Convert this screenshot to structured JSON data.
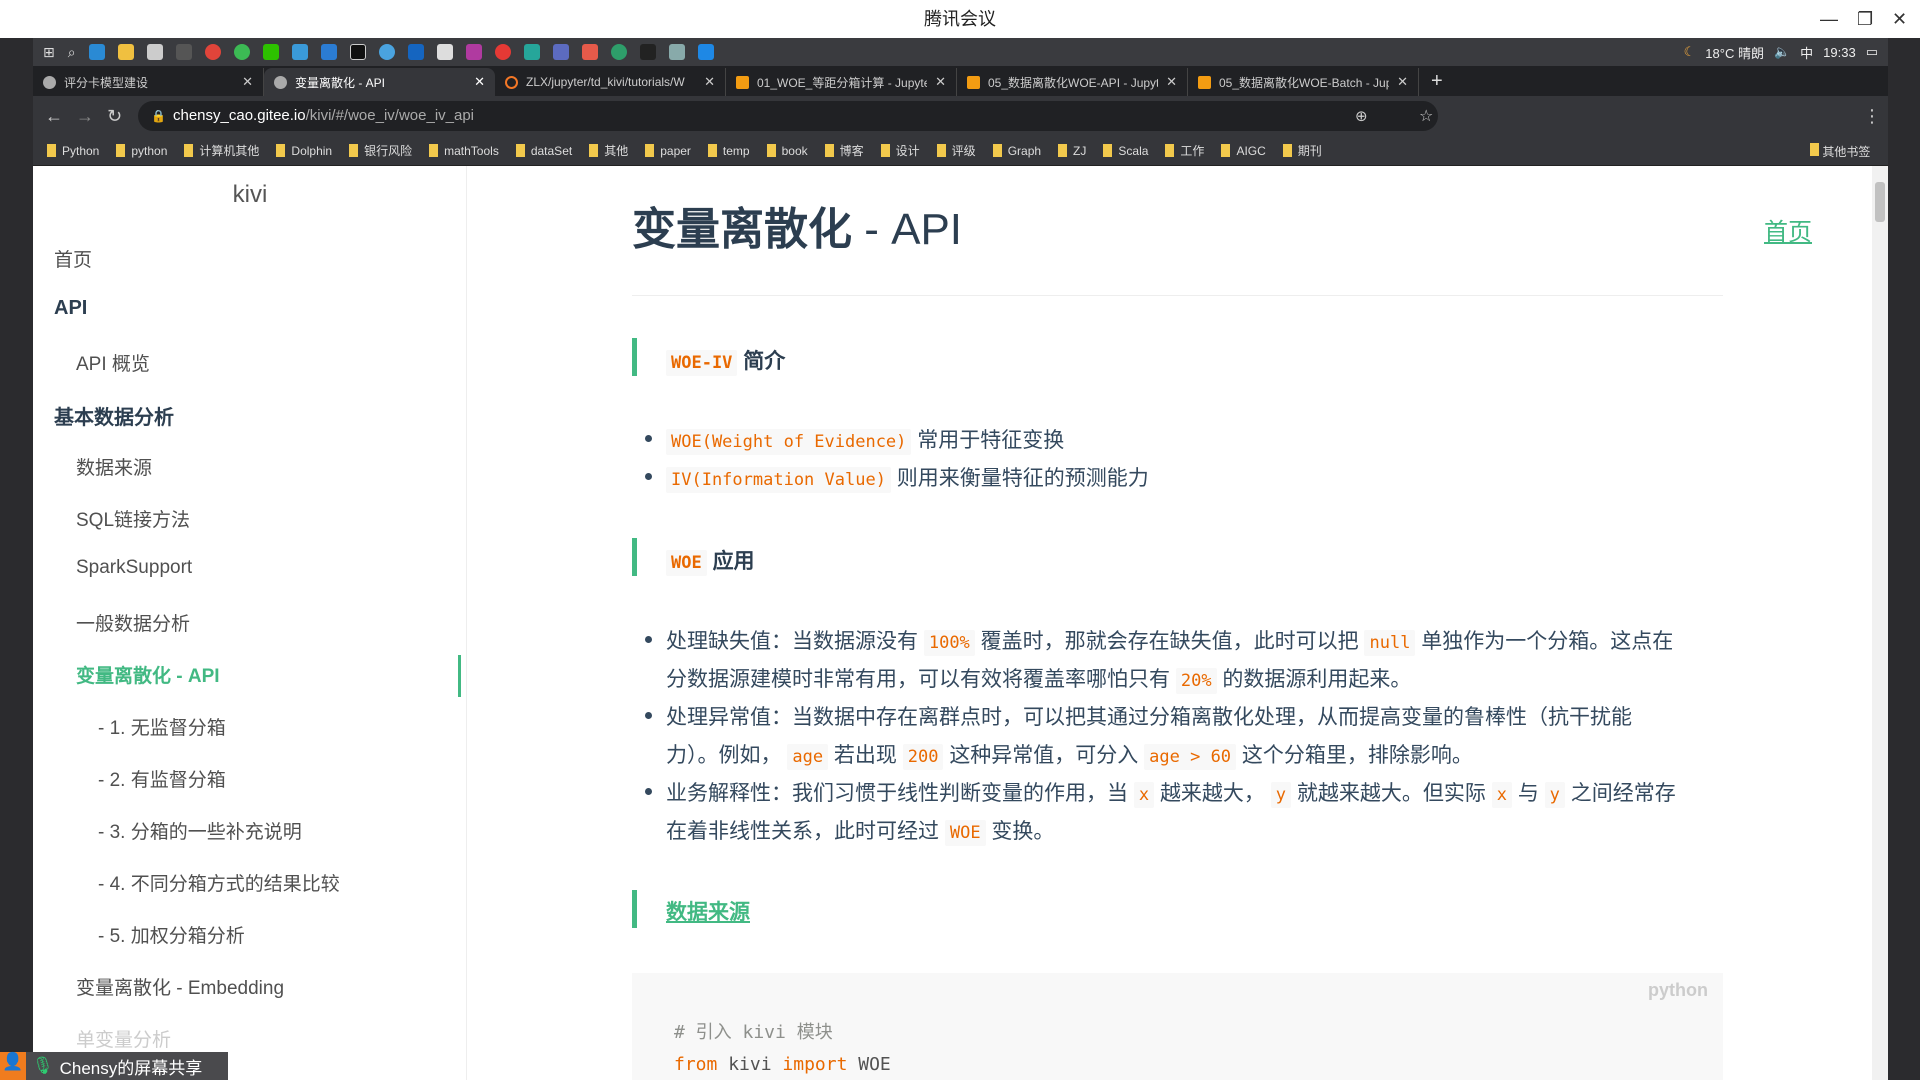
{
  "window": {
    "title": "腾讯会议"
  },
  "taskbar": {
    "weather": "18°C 晴朗",
    "ime": "中",
    "time": "19:33"
  },
  "tabs": [
    {
      "label": "评分卡模型建设"
    },
    {
      "label": "变量离散化 - API",
      "active": true
    },
    {
      "label": "ZLX/jupyter/td_kivi/tutorials/W"
    },
    {
      "label": "01_WOE_等距分箱计算 - Jupyte"
    },
    {
      "label": "05_数据离散化WOE-API - Jupyt"
    },
    {
      "label": "05_数据离散化WOE-Batch - Jup"
    }
  ],
  "address": {
    "host": "chensy_cao.gitee.io",
    "path": "/kivi/#/woe_iv/woe_iv_api"
  },
  "bookmarks": [
    "Python",
    "python",
    "计算机其他",
    "Dolphin",
    "银行风险",
    "mathTools",
    "dataSet",
    "其他",
    "paper",
    "temp",
    "book",
    "博客",
    "设计",
    "评级",
    "Graph",
    "ZJ",
    "Scala",
    "工作",
    "AIGC",
    "期刊"
  ],
  "other_bookmarks": "其他书签",
  "sidebar": {
    "title": "kivi",
    "items": [
      {
        "label": "首页",
        "level": 0
      },
      {
        "label": "API",
        "level": "h"
      },
      {
        "label": "API 概览",
        "level": 1
      },
      {
        "label": "基本数据分析",
        "level": "h"
      },
      {
        "label": "数据来源",
        "level": 1
      },
      {
        "label": "SQL链接方法",
        "level": 1
      },
      {
        "label": "SparkSupport",
        "level": 1
      },
      {
        "label": "一般数据分析",
        "level": 1
      },
      {
        "label": "变量离散化 - API",
        "level": 1,
        "active": true
      },
      {
        "label": "- 1. 无监督分箱",
        "level": 2
      },
      {
        "label": "- 2. 有监督分箱",
        "level": 2
      },
      {
        "label": "- 3. 分箱的一些补充说明",
        "level": 2
      },
      {
        "label": "- 4. 不同分箱方式的结果比较",
        "level": 2
      },
      {
        "label": "- 5. 加权分箱分析",
        "level": 2
      },
      {
        "label": "变量离散化 - Embedding",
        "level": 1
      },
      {
        "label": "单变量分析",
        "level": 1,
        "faded": true
      }
    ]
  },
  "main": {
    "title_a": "变量离散化",
    "title_b": " - API",
    "home_link": "首页",
    "s1": {
      "code": "WOE-IV",
      "text": "简介"
    },
    "s1_items": [
      {
        "code": "WOE(Weight of Evidence)",
        "text": "常用于特征变换"
      },
      {
        "code": "IV(Information Value)",
        "text": "则用来衡量特征的预测能力"
      }
    ],
    "s2": {
      "code": "WOE",
      "text": "应用"
    },
    "b1": {
      "a": "处理缺失值：当数据源没有",
      "c1": "100%",
      "b": "覆盖时，那就会存在缺失值，此时可以把",
      "c2": "null",
      "c": "单独作为一个分箱。这点在",
      "d": "分数据源建模时非常有用，可以有效将覆盖率哪怕只有",
      "c3": "20%",
      "e": "的数据源利用起来。"
    },
    "b2": {
      "a": "处理异常值：当数据中存在离群点时，可以把其通过分箱离散化处理，从而提高变量的鲁棒性（抗干扰能",
      "b": "力）。例如，",
      "c1": "age",
      "c": "若出现",
      "c2": "200",
      "d": "这种异常值，可分入",
      "c3": "age > 60",
      "e": "这个分箱里，排除影响。"
    },
    "b3": {
      "a": "业务解释性：我们习惯于线性判断变量的作用，当",
      "c1": "x",
      "b": "越来越大，",
      "c2": "y",
      "c": "就越来越大。但实际",
      "c3": "x",
      "d": "与",
      "c4": "y",
      "e": "之间经常存",
      "f": "在着非线性关系，此时可经过",
      "c5": "WOE",
      "g": "变换。"
    },
    "s3": "数据来源",
    "code": {
      "lang": "python",
      "comment": "# 引入 kivi 模块",
      "kw1": "from",
      "mod": " kivi ",
      "kw2": "import",
      "name": " WOE"
    }
  },
  "share": {
    "label": "Chensy的屏幕共享"
  },
  "colors": {
    "accent": "#42b983",
    "code": "#e96900",
    "text": "#34495e"
  }
}
